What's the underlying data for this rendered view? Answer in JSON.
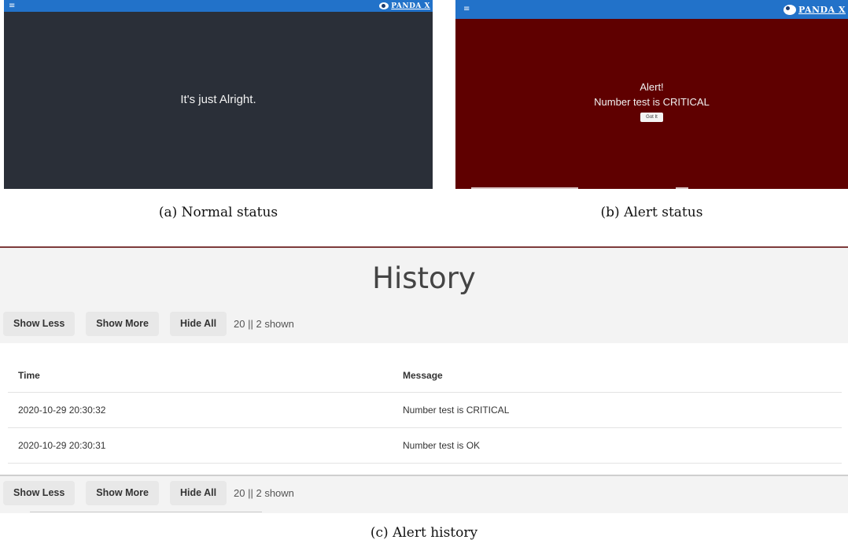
{
  "panel_a": {
    "message": "It's just Alright.",
    "caption": "(a) Normal status",
    "menu_icon": "hamburger-menu-icon",
    "logo_text": "PANDA X"
  },
  "panel_b": {
    "alert_title": "Alert!",
    "alert_message": "Number test is CRITICAL",
    "ack_button": "Got It",
    "caption": "(b) Alert status",
    "menu_icon": "hamburger-menu-icon",
    "logo_text": "PANDA X"
  },
  "history": {
    "title": "History",
    "controls": {
      "show_less": "Show Less",
      "show_more": "Show More",
      "hide_all": "Hide All",
      "shown_text": "20 || 2 shown"
    },
    "columns": [
      "Time",
      "Message"
    ],
    "rows": [
      {
        "time": "2020-10-29 20:30:32",
        "message": "Number test is CRITICAL"
      },
      {
        "time": "2020-10-29 20:30:31",
        "message": "Number test is OK"
      }
    ],
    "caption": "(c) Alert history"
  },
  "colors": {
    "topbar": "#2272c9",
    "normal_bg": "#2a2f38",
    "alert_bg": "#5f0000",
    "history_bg": "#f3f3f3"
  }
}
